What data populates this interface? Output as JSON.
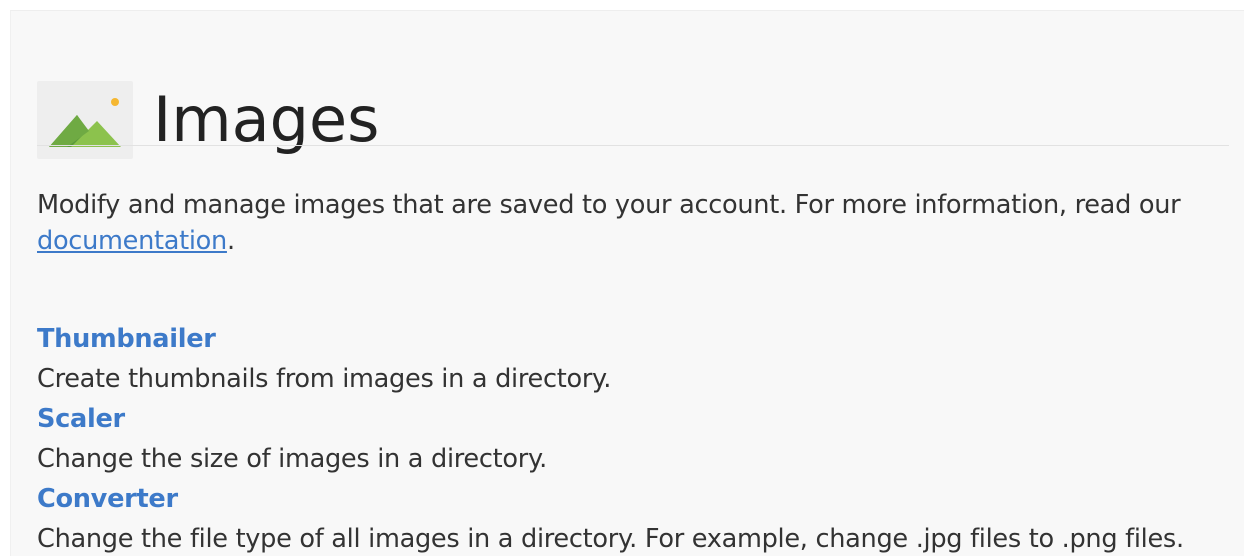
{
  "header": {
    "title": "Images",
    "icon": "mountains-sun-icon",
    "icon_colors": {
      "mountain_dark": "#5c9a3c",
      "mountain_light": "#8cc24d",
      "sun": "#f5b731"
    }
  },
  "intro": {
    "text": "Modify and manage images that are saved to your account. For more information, read our ",
    "link_text": "documentation",
    "trailing": "."
  },
  "tools": [
    {
      "name": "Thumbnailer",
      "description": "Create thumbnails from images in a directory."
    },
    {
      "name": "Scaler",
      "description": "Change the size of images in a directory."
    },
    {
      "name": "Converter",
      "description": "Change the file type of all images in a directory. For example, change .jpg files to .png files."
    }
  ],
  "colors": {
    "link": "#3d7ac9",
    "text": "#333333",
    "title": "#222222"
  }
}
